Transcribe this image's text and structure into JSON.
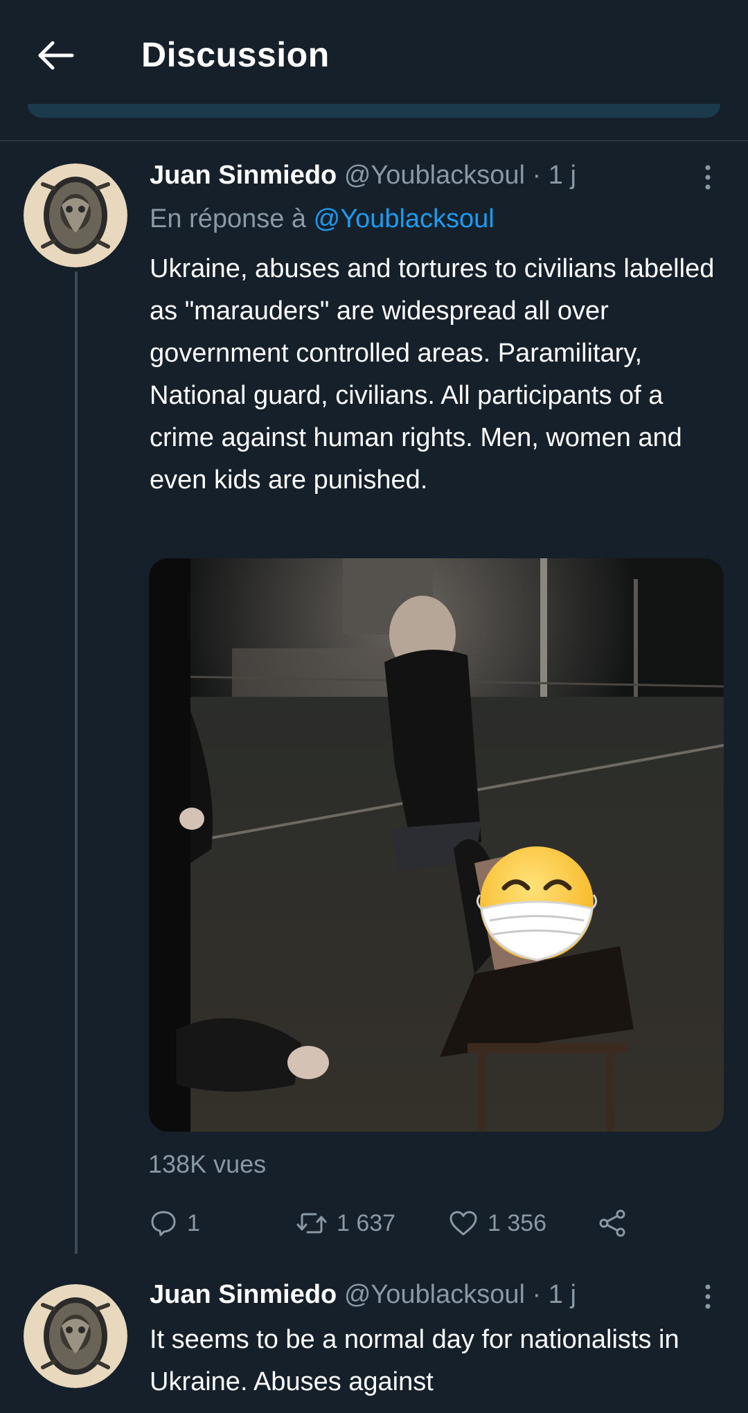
{
  "header": {
    "title": "Discussion"
  },
  "tweets": [
    {
      "author_name": "Juan Sinmiedo",
      "author_handle": "@Youblacksoul",
      "separator": "·",
      "time": "1 j",
      "reply_prefix": "En réponse à",
      "reply_handle": "@Youblacksoul",
      "text": "Ukraine, abuses and tortures to civilians labelled as \"marauders\" are widespread all over government controlled areas. Paramilitary, National guard, civilians. All participants of a crime against human rights. Men, women and even kids are punished.",
      "views": "138K vues",
      "reply_count": "1",
      "retweet_count": "1 637",
      "like_count": "1 356"
    },
    {
      "author_name": "Juan Sinmiedo",
      "author_handle": "@Youblacksoul",
      "separator": "·",
      "time": "1 j",
      "text": "It seems to be a normal day for nationalists in Ukraine. Abuses against"
    }
  ],
  "icons": {
    "back": "arrow-left-icon",
    "more": "more-vertical-icon",
    "reply": "chat-bubble-icon",
    "retweet": "retweet-icon",
    "like": "heart-icon",
    "share": "share-icon"
  },
  "colors": {
    "background": "#15202b",
    "link": "#1d9bf0",
    "secondary_text": "#8b98a5",
    "divider": "#2b3640"
  }
}
